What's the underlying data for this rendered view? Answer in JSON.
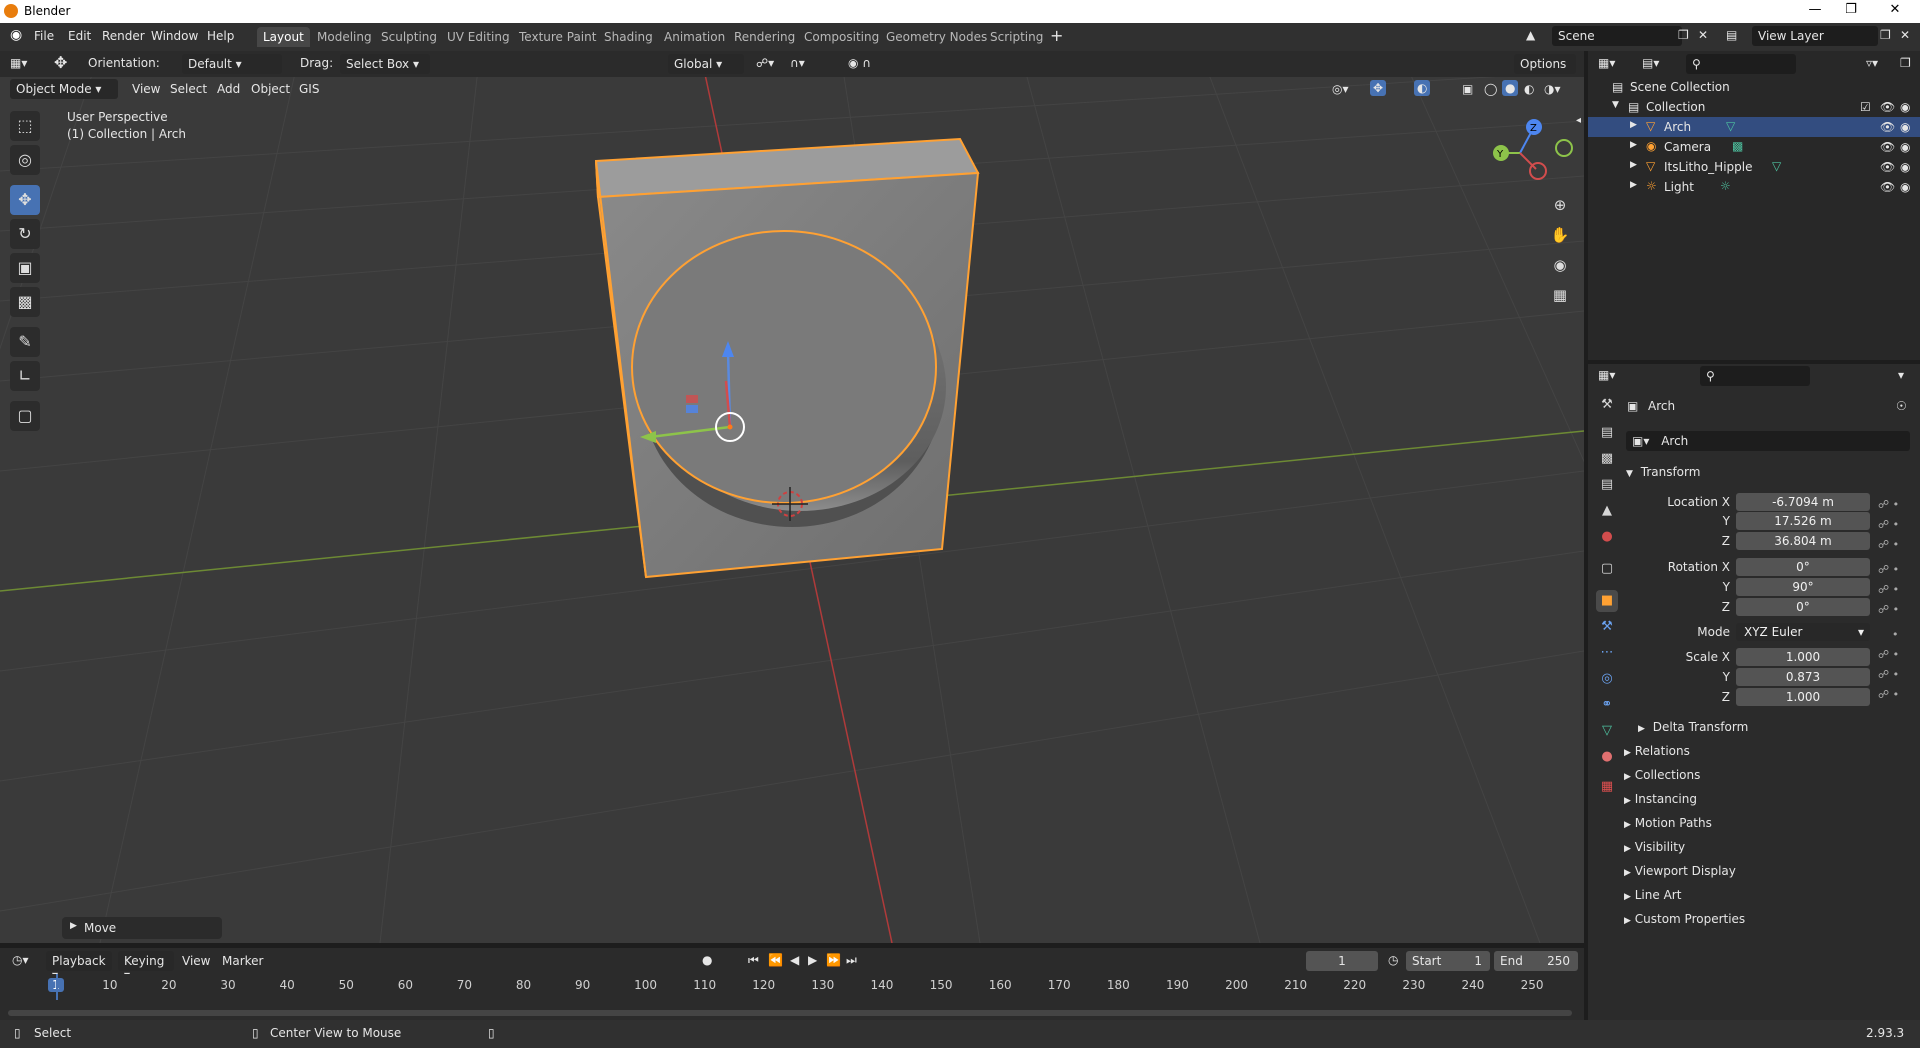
{
  "window": {
    "title": "Blender"
  },
  "menus": [
    "File",
    "Edit",
    "Render",
    "Window",
    "Help"
  ],
  "workspaces": [
    "Layout",
    "Modeling",
    "Sculpting",
    "UV Editing",
    "Texture Paint",
    "Shading",
    "Animation",
    "Rendering",
    "Compositing",
    "Geometry Nodes",
    "Scripting"
  ],
  "scene": {
    "name": "Scene",
    "view_layer": "View Layer"
  },
  "tool_header": {
    "orientation_label": "Orientation:",
    "orientation_value": "Default",
    "drag_label": "Drag:",
    "drag_value": "Select Box",
    "transform_space": "Global",
    "options": "Options"
  },
  "viewport_header": {
    "mode": "Object Mode",
    "menus": [
      "View",
      "Select",
      "Add",
      "Object",
      "GIS"
    ]
  },
  "viewport": {
    "perspective": "User Perspective",
    "collection_info": "(1) Collection | Arch",
    "last_op": "Move",
    "gizmo_labels": {
      "z": "Z",
      "y": "Y"
    }
  },
  "outliner": {
    "root": "Scene Collection",
    "collection": "Collection",
    "items": [
      {
        "name": "Arch",
        "selected": true
      },
      {
        "name": "Camera",
        "selected": false
      },
      {
        "name": "ItsLitho_Hipple",
        "selected": false
      },
      {
        "name": "Light",
        "selected": false
      }
    ]
  },
  "properties": {
    "object_name": "Arch",
    "data_name": "Arch",
    "transform_title": "Transform",
    "location": {
      "label": "Location X",
      "x": "-6.7094 m",
      "y": "17.526 m",
      "z": "36.804 m"
    },
    "rotation": {
      "label": "Rotation X",
      "x": "0°",
      "y": "90°",
      "z": "0°"
    },
    "mode_label": "Mode",
    "mode_value": "XYZ Euler",
    "scale": {
      "label": "Scale X",
      "x": "1.000",
      "y": "0.873",
      "z": "1.000"
    },
    "axis_y": "Y",
    "axis_z": "Z",
    "delta": "Delta Transform",
    "panels": [
      "Relations",
      "Collections",
      "Instancing",
      "Motion Paths",
      "Visibility",
      "Viewport Display",
      "Line Art",
      "Custom Properties"
    ]
  },
  "timeline": {
    "menus": [
      "Playback",
      "Keying",
      "View",
      "Marker"
    ],
    "current_frame": "1",
    "start_label": "Start",
    "start": "1",
    "end_label": "End",
    "end": "250",
    "ticks": [
      "1",
      "10",
      "20",
      "30",
      "40",
      "50",
      "60",
      "70",
      "80",
      "90",
      "100",
      "110",
      "120",
      "130",
      "140",
      "150",
      "160",
      "170",
      "180",
      "190",
      "200",
      "210",
      "220",
      "230",
      "240",
      "250"
    ]
  },
  "statusbar": {
    "select": "Select",
    "center": "Center View to Mouse",
    "version": "2.93.3"
  },
  "colors": {
    "accent": "#4772b3",
    "selection_orange": "#ffa133",
    "x_axis": "#c83b3b",
    "y_axis": "#7ea83c"
  }
}
